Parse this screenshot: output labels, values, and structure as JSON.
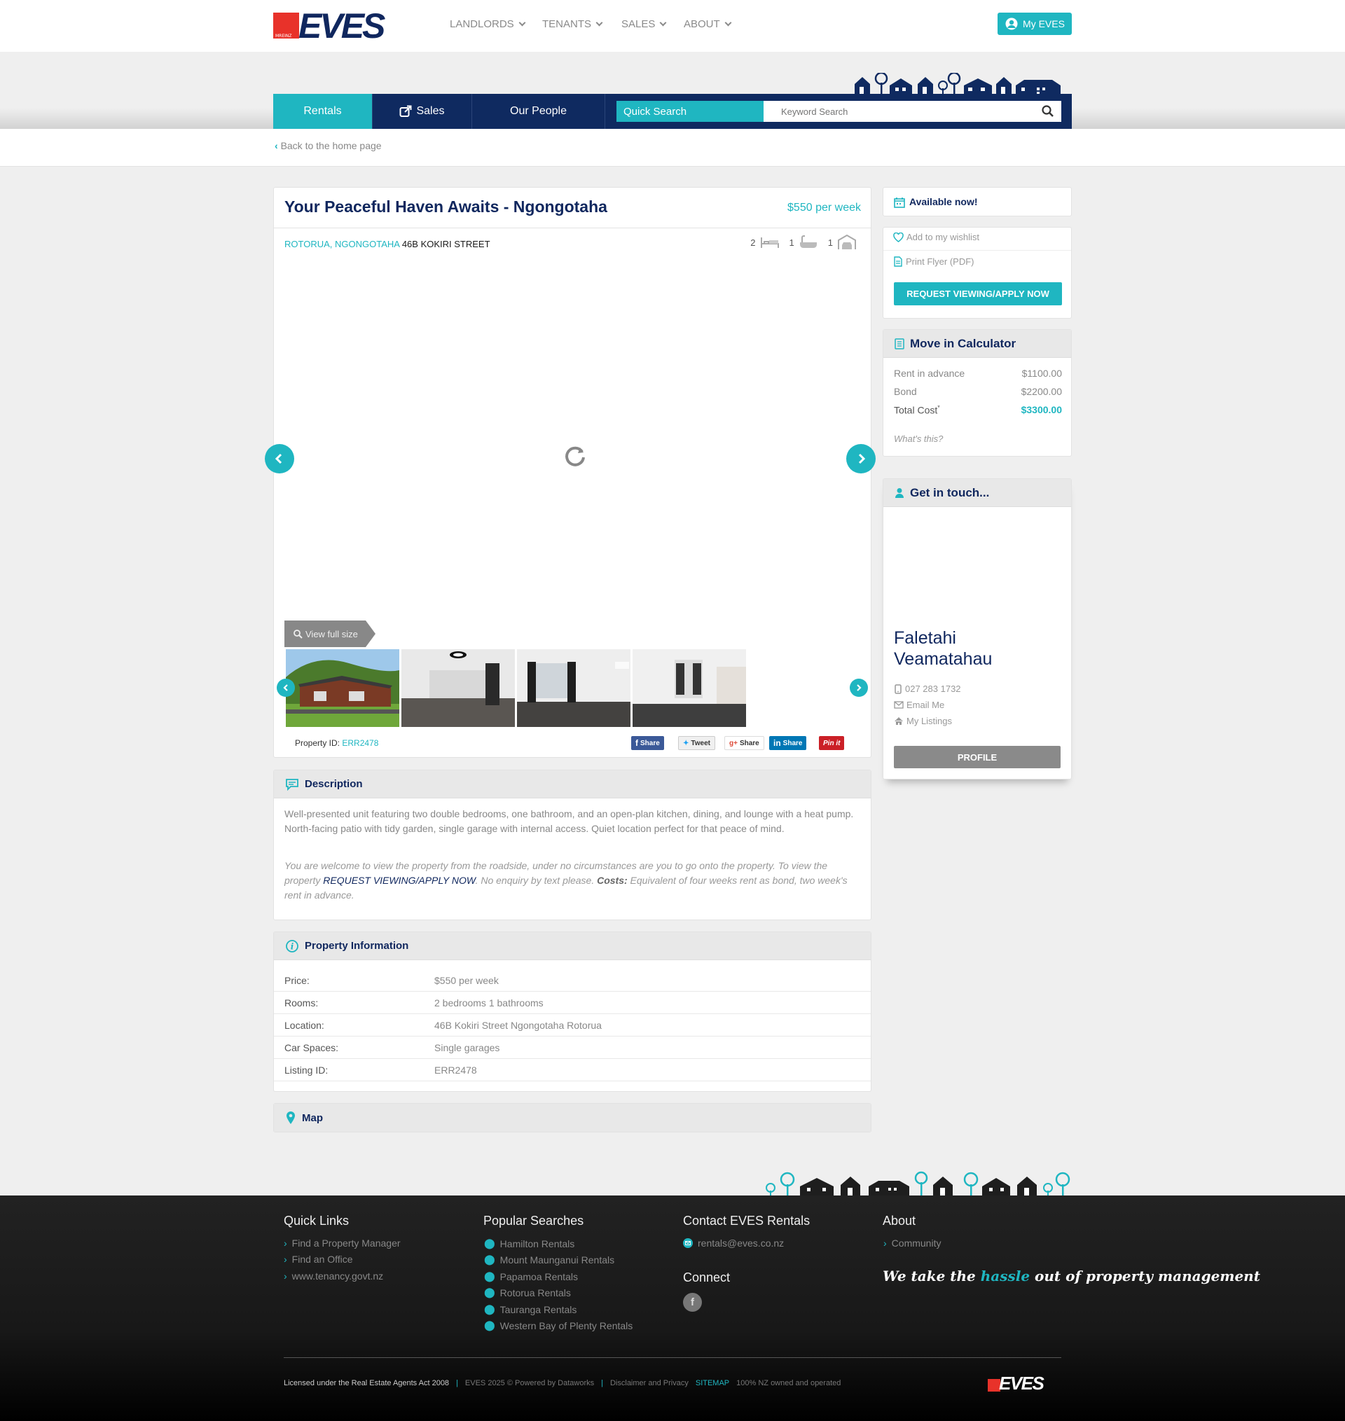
{
  "header": {
    "logo_text": "EVES",
    "logo_small": "MREINZ",
    "nav": [
      {
        "label": "LANDLORDS"
      },
      {
        "label": "TENANTS"
      },
      {
        "label": "SALES"
      },
      {
        "label": "ABOUT"
      }
    ],
    "my_eves_label": "My EVES",
    "accent_color": "#1fb6c1",
    "brand_color": "#10275e",
    "logo_red": "#e8322a"
  },
  "tabs": {
    "rentals": "Rentals",
    "sales": "Sales",
    "people": "Our People",
    "quick_search": "Quick Search",
    "search_placeholder": "Keyword Search"
  },
  "back_link": "Back to the home page",
  "listing": {
    "title": "Your Peaceful Haven Awaits - Ngongotaha",
    "price": "$550 per week",
    "suburb": "ROTORUA, NGONGOTAHA",
    "street": "46B KOKIRI STREET",
    "bedrooms": "2",
    "bathrooms": "1",
    "garages": "1",
    "view_full_size": "View full size",
    "property_id_label": "Property ID:",
    "property_id": "ERR2478"
  },
  "share": {
    "facebook": "Share",
    "twitter": "Tweet",
    "google": "Share",
    "linkedin": "Share",
    "pinterest": "Pin it"
  },
  "description": {
    "heading": "Description",
    "text": "Well-presented unit featuring two double bedrooms, one bathroom, and an open-plan kitchen, dining, and lounge with a heat pump. North-facing patio with tidy garden, single garage with internal access. Quiet location perfect for that peace of mind.",
    "note_1": "You are welcome to view the property from the roadside, under no circumstances are you to go onto the property. To view the property ",
    "note_link": "REQUEST VIEWING/APPLY NOW",
    "note_2": ". No enquiry by text please. ",
    "costs_label": "Costs:",
    "note_3": " Equivalent of four weeks rent as bond, two week's rent in advance."
  },
  "property_info": {
    "heading": "Property Information",
    "rows": [
      {
        "key": "Price:",
        "value": "$550 per week"
      },
      {
        "key": "Rooms:",
        "value": "2 bedrooms 1 bathrooms"
      },
      {
        "key": "Location:",
        "value": "46B Kokiri Street Ngongotaha Rotorua"
      },
      {
        "key": "Car Spaces:",
        "value": "Single garages"
      },
      {
        "key": "Listing ID:",
        "value": "ERR2478"
      }
    ]
  },
  "map": {
    "heading": "Map"
  },
  "sidebar": {
    "available": "Available now!",
    "wishlist": "Add to my wishlist",
    "print_flyer": "Print Flyer (PDF)",
    "request_btn": "REQUEST VIEWING/APPLY NOW",
    "calc_heading": "Move in Calculator",
    "calc_rows": [
      {
        "label": "Rent in advance",
        "value": "$1100.00"
      },
      {
        "label": "Bond",
        "value": "$2200.00"
      },
      {
        "label": "Total Cost",
        "value": "$3300.00"
      }
    ],
    "calc_asterisk": "*",
    "whats_this": "What's this?",
    "touch_heading": "Get in touch...",
    "agent_first": "Faletahi",
    "agent_last": "Veamatahau",
    "agent_phone": "027 283 1732",
    "agent_email": "Email Me",
    "agent_listings": "My Listings",
    "profile_btn": "PROFILE"
  },
  "footer": {
    "quick_links_heading": "Quick Links",
    "quick_links": [
      "Find a Property Manager",
      "Find an Office",
      "www.tenancy.govt.nz"
    ],
    "popular_heading": "Popular Searches",
    "popular": [
      "Hamilton Rentals",
      "Mount Maunganui Rentals",
      "Papamoa Rentals",
      "Rotorua Rentals",
      "Tauranga Rentals",
      "Western Bay of Plenty Rentals"
    ],
    "contact_heading": "Contact EVES Rentals",
    "contact_email": "rentals@eves.co.nz",
    "connect_heading": "Connect",
    "about_heading": "About",
    "about_links": [
      "Community"
    ],
    "slogan_1": "We take the ",
    "slogan_hl": "hassle",
    "slogan_2": " out of property management",
    "licensed": "Licensed under the Real Estate Agents Act 2008",
    "copyright": "EVES 2025 © Powered by Dataworks",
    "disclaimer": "Disclaimer and Privacy",
    "sitemap": "SITEMAP",
    "nz_owned": "100% NZ owned and operated",
    "logo_text": "EVES"
  }
}
